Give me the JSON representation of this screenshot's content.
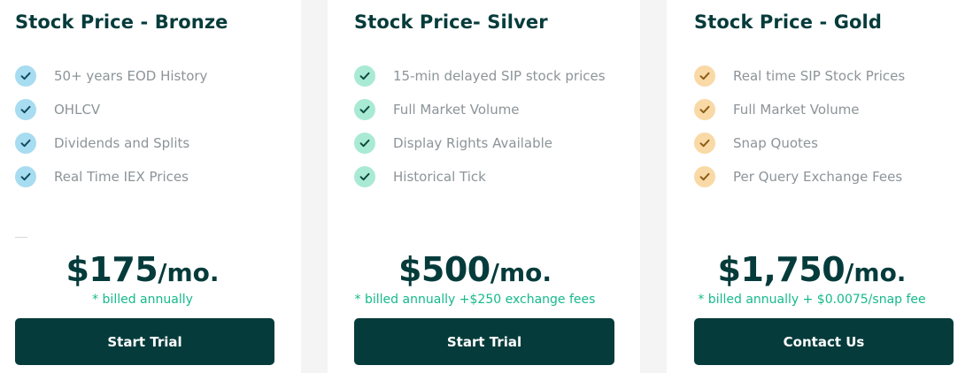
{
  "plans": [
    {
      "title": "Stock Price - Bronze",
      "check_bg": "#a8dcf0",
      "check_color": "#0e4a5c",
      "features": [
        "50+ years EOD History",
        "OHLCV",
        "Dividends and Splits",
        "Real Time IEX Prices"
      ],
      "price": "$175",
      "period": "/mo.",
      "billing": "* billed annually",
      "cta_label": "Start Trial"
    },
    {
      "title": "Stock Price- Silver",
      "check_bg": "#a9ead4",
      "check_color": "#0b4a3c",
      "features": [
        "15-min delayed SIP stock prices",
        "Full Market Volume",
        "Display Rights Available",
        "Historical Tick"
      ],
      "price": "$500",
      "period": "/mo.",
      "billing": "* billed annually +$250 exchange fees",
      "cta_label": "Start Trial"
    },
    {
      "title": "Stock Price - Gold",
      "check_bg": "#f9d9a6",
      "check_color": "#8a5a14",
      "features": [
        "Real time SIP Stock Prices",
        "Full Market Volume",
        "Snap Quotes",
        "Per Query Exchange Fees"
      ],
      "price": "$1,750",
      "period": "/mo.",
      "billing": "* billed annually + $0.0075/snap fee",
      "cta_label": "Contact Us"
    }
  ],
  "colors": {
    "brand_dark": "#063b3b",
    "accent_green": "#16b98c",
    "feature_text": "#8c9498",
    "background": "#f3f4f3"
  },
  "icons": {
    "feature_check": "check-icon"
  }
}
